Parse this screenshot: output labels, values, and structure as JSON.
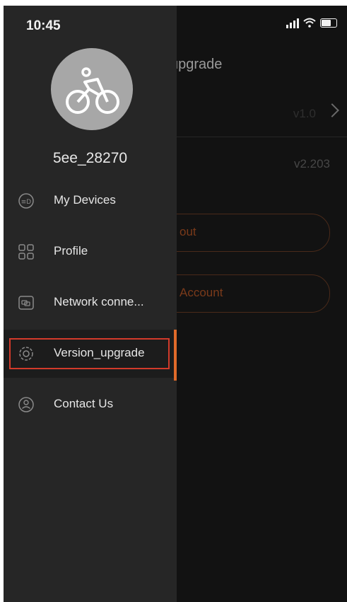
{
  "status_bar": {
    "time": "10:45"
  },
  "background_page": {
    "title": "upgrade",
    "row1_value": "v1.0",
    "row2_value": "v2.203",
    "button1_label": "out",
    "button2_label": "Account"
  },
  "drawer": {
    "username": "5ee_28270",
    "menu": [
      {
        "label": "My Devices",
        "icon": "devices-icon"
      },
      {
        "label": "Profile",
        "icon": "grid-icon"
      },
      {
        "label": "Network conne...",
        "icon": "network-icon"
      },
      {
        "label": "Version_upgrade",
        "icon": "gear-icon",
        "selected": true
      },
      {
        "label": "Contact Us",
        "icon": "contact-icon"
      }
    ]
  },
  "colors": {
    "accent": "#e06a2a",
    "highlight_box": "#d23a2a",
    "drawer_bg": "#262626"
  }
}
